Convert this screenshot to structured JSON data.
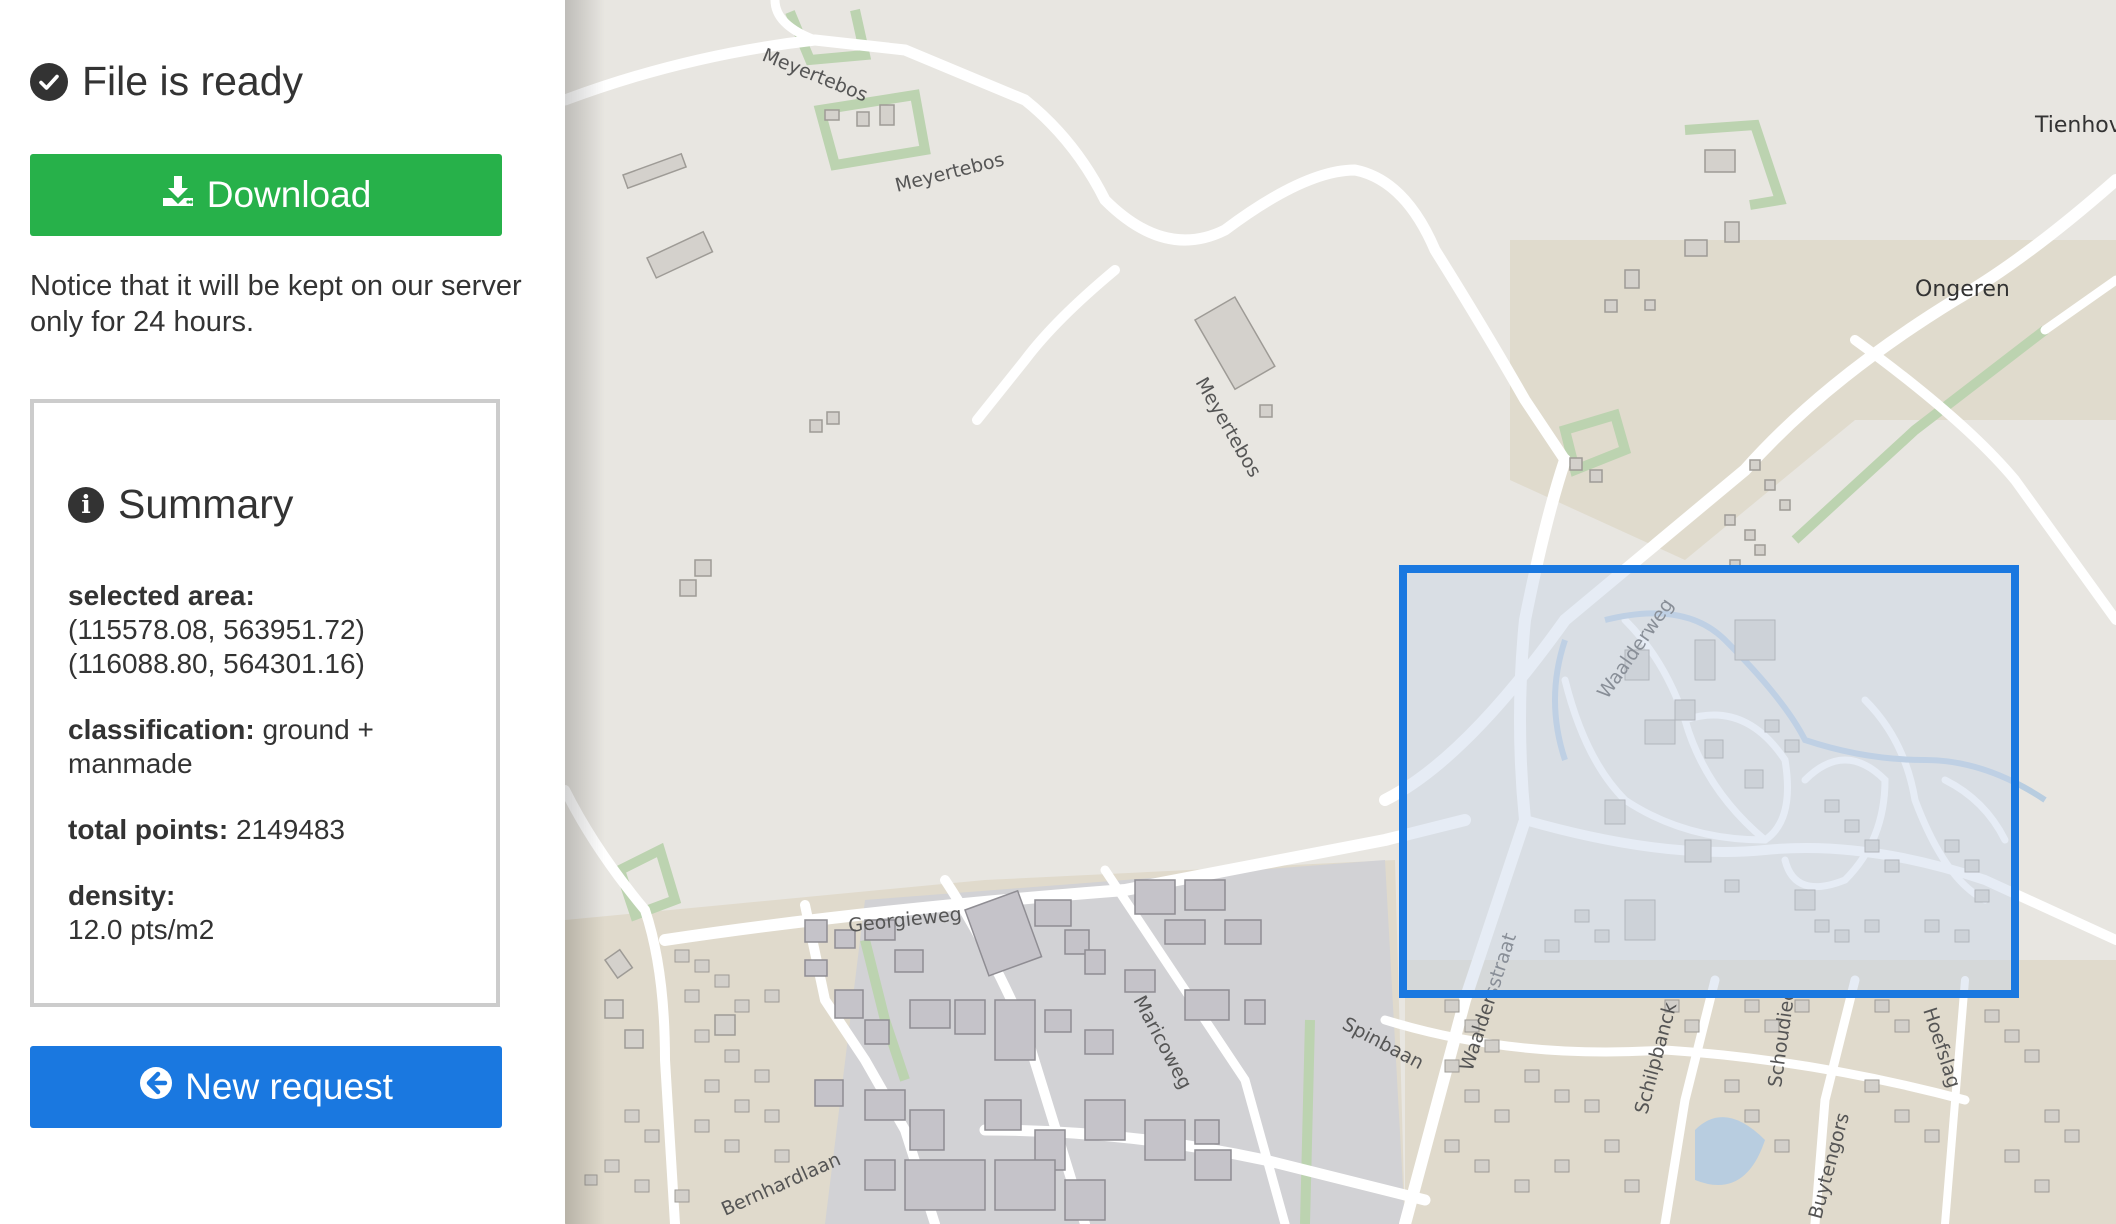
{
  "status": {
    "text": "File is ready"
  },
  "download_button": {
    "label": "Download"
  },
  "notice": "Notice that it will be kept on our server only for 24 hours.",
  "summary": {
    "title": "Summary",
    "selected_area_label": "selected area:",
    "selected_area_line1": "(115578.08, 563951.72)",
    "selected_area_line2": "(116088.80, 564301.16)",
    "classification_label": "classification:",
    "classification_value": "ground + manmade",
    "total_points_label": "total points:",
    "total_points_value": "2149483",
    "density_label": "density:",
    "density_value": "12.0 pts/m2"
  },
  "new_request_button": {
    "label": "New request"
  },
  "map": {
    "labels": {
      "meyertebos_1": "Meyertebos",
      "meyertebos_2": "Meyertebos",
      "meyertebos_3": "Meyertebos",
      "tienhoven": "Tienhov",
      "ongeren": "Ongeren",
      "waalderweg": "Waalderweg",
      "georgieweg": "Georgieweg",
      "maricoweg": "Maricoweg",
      "spinbaan": "Spinbaan",
      "waaldersstraat": "Waaldersstraat",
      "schilpbanck": "Schilpbanck",
      "schoudiec": "Schoudiec",
      "hoefslag": "Hoefslag",
      "bernhardlaan": "Bernhardlaan",
      "buytengors": "Buytengors"
    }
  },
  "colors": {
    "download_green": "#27b14a",
    "primary_blue": "#1a78e0",
    "selection_blue": "#1a78e0",
    "map_background": "#e8e6e1"
  }
}
